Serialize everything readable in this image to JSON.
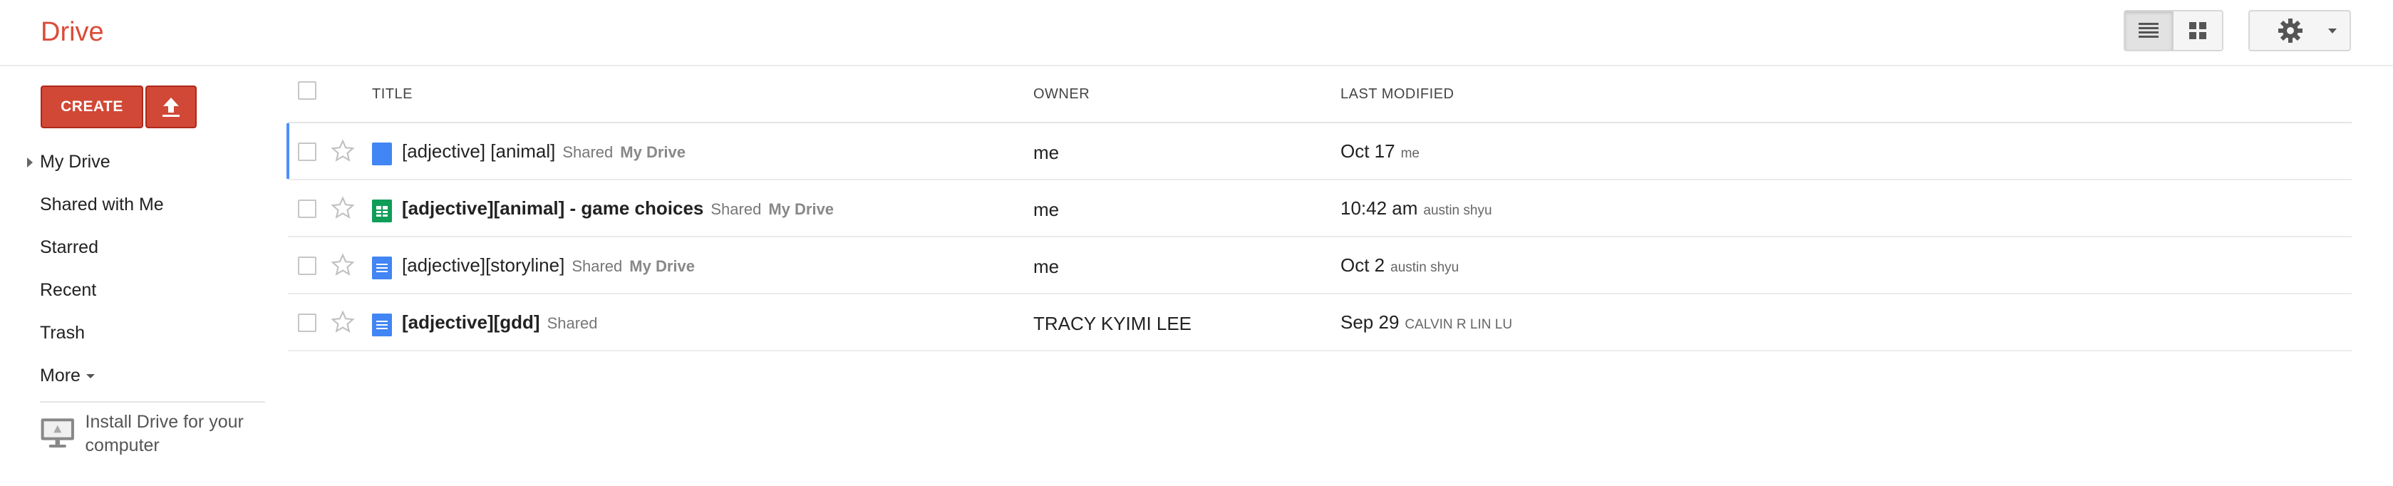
{
  "header": {
    "logo": "Drive",
    "view_list_icon": "list-view-icon",
    "view_grid_icon": "grid-view-icon",
    "settings_icon": "gear-icon"
  },
  "sidebar": {
    "create_label": "CREATE",
    "upload_icon": "upload-icon",
    "nav": [
      {
        "label": "My Drive",
        "has_expander": true
      },
      {
        "label": "Shared with Me"
      },
      {
        "label": "Starred"
      },
      {
        "label": "Recent"
      },
      {
        "label": "Trash"
      },
      {
        "label": "More"
      }
    ],
    "install": {
      "text": "Install Drive for your computer"
    }
  },
  "list": {
    "columns": {
      "title": "TITLE",
      "owner": "OWNER",
      "modified": "LAST MODIFIED"
    },
    "rows": [
      {
        "title": "[adjective] [animal]",
        "bold": false,
        "type": "doc",
        "shared": "Shared",
        "location": "My Drive",
        "owner": "me",
        "modified": "Oct 17",
        "modified_by": "me",
        "selected": true
      },
      {
        "title": "[adjective][animal] - game choices",
        "bold": true,
        "type": "sheet",
        "shared": "Shared",
        "location": "My Drive",
        "owner": "me",
        "modified": "10:42 am",
        "modified_by": "austin shyu",
        "selected": false
      },
      {
        "title": "[adjective][storyline]",
        "bold": false,
        "type": "doc",
        "shared": "Shared",
        "location": "My Drive",
        "owner": "me",
        "modified": "Oct 2",
        "modified_by": "austin shyu",
        "selected": false
      },
      {
        "title": "[adjective][gdd]",
        "bold": true,
        "type": "doc",
        "shared": "Shared",
        "location": "",
        "owner": "TRACY KYIMI LEE",
        "modified": "Sep 29",
        "modified_by": "CALVIN R LIN LU",
        "selected": false
      }
    ]
  },
  "colors": {
    "brand_red": "#dd4b39",
    "create_red": "#d14836",
    "select_blue": "#4d90fe",
    "doc_blue": "#4285f4",
    "sheet_green": "#0f9d58"
  }
}
